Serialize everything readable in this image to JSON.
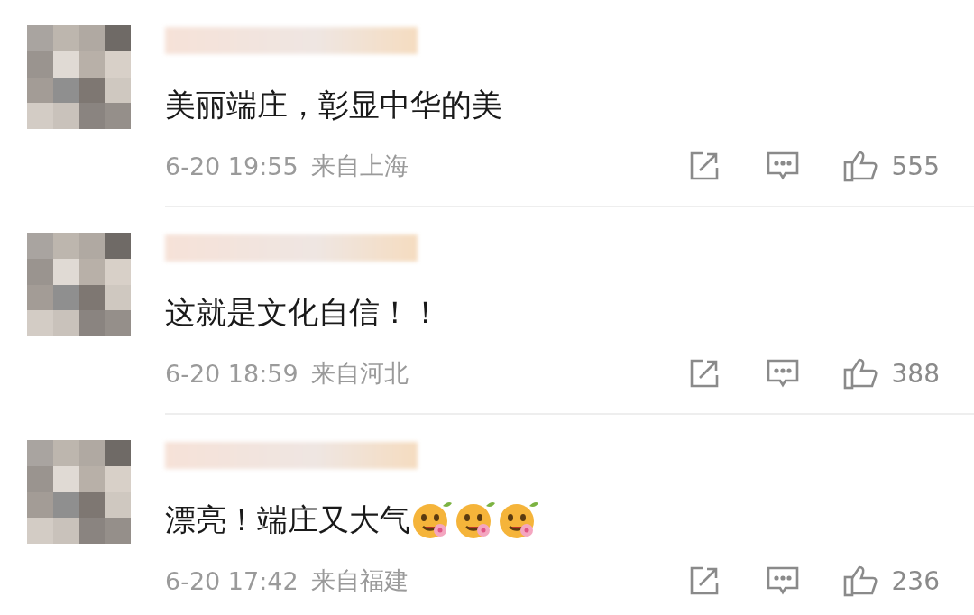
{
  "comments": [
    {
      "text": "美丽端庄，彰显中华的美",
      "time": "6-20 19:55",
      "location": "来自上海",
      "likes": "555"
    },
    {
      "text": "这就是文化自信！！",
      "time": "6-20 18:59",
      "location": "来自河北",
      "likes": "388"
    },
    {
      "text": "漂亮！端庄又大气",
      "emojis": [
        {
          "kind": "sticker"
        },
        {
          "kind": "sticker"
        },
        {
          "kind": "sticker"
        }
      ],
      "time": "6-20 17:42",
      "location": "来自福建",
      "likes": "236"
    }
  ]
}
